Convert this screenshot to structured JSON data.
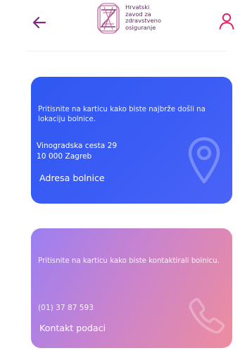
{
  "header": {
    "logo_text": "Hrvatski\nzavod za\nzdravstveno\nosiguranje",
    "back_icon": "arrow-left-icon",
    "profile_icon": "user-icon",
    "accent_color": "#7b2a7f"
  },
  "cards": {
    "hospital": {
      "hint": "Pritisnite na karticu kako biste najbrže došli na lokaciju bolnice.",
      "street": "Vinogradska cesta 29",
      "city": "10 000 Zagreb",
      "title": "Adresa bolnice",
      "icon": "location-pin-icon",
      "color": "#3259f3"
    },
    "contact": {
      "hint": "Pritisnite na karticu kako biste kontaktirali bolnicu.",
      "phone": "(01) 37 87 593",
      "title": "Kontakt podaci",
      "icon": "phone-icon",
      "color_start": "#9b7ff2",
      "color_end": "#ee8d9e"
    }
  }
}
